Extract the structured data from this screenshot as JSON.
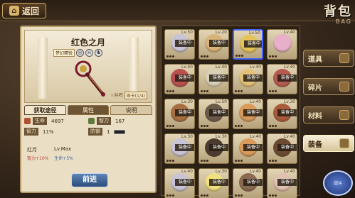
{
  "header": {
    "back_label": "返回",
    "back_icon": "home-icon",
    "title": "背包",
    "subtitle": "BAG"
  },
  "item_detail": {
    "name": "红色之月",
    "rarity_tag": "梦幻精锐",
    "acquire_label": "获取途径",
    "tabs": [
      "属性",
      "说明"
    ],
    "rank_label": "☆共鸣",
    "rank_value": "珠卡(1/4)",
    "stats": [
      {
        "label": "生命",
        "value": "4697"
      },
      {
        "label": "智力",
        "value": "167"
      }
    ],
    "stats2": [
      {
        "label": "智力",
        "value": "11%"
      },
      {
        "label": "防御",
        "value": "1"
      }
    ],
    "skill_name": "红月",
    "skill_level": "Lv.Max",
    "bonus_lines": [
      "智力+10%",
      "生命+5%"
    ],
    "equip_label": "前进"
  },
  "grid": {
    "equipped_label": "装备中",
    "items": [
      {
        "lv": "Lv.50",
        "eq": true,
        "color": "#c9c3d6"
      },
      {
        "lv": "Lv.20",
        "eq": true,
        "color": "#d8b37a"
      },
      {
        "lv": "Lv.50",
        "eq": true,
        "color": "#e5c35a",
        "selected": true
      },
      {
        "lv": "Lv.40",
        "eq": false,
        "color": "#e7b0c8"
      },
      {
        "lv": "Lv.40",
        "eq": true,
        "color": "#b85050"
      },
      {
        "lv": "Lv.40",
        "eq": true,
        "color": "#d9d0b8"
      },
      {
        "lv": "Lv.40",
        "eq": true,
        "color": "#e2c27a"
      },
      {
        "lv": "Lv.40",
        "eq": true,
        "color": "#b55a50"
      },
      {
        "lv": "Lv.30",
        "eq": true,
        "color": "#a87040"
      },
      {
        "lv": "Lv.50",
        "eq": true,
        "color": "#6a5a4a"
      },
      {
        "lv": "Lv.40",
        "eq": true,
        "color": "#d99a5a"
      },
      {
        "lv": "Lv.30",
        "eq": true,
        "color": "#a85a3a"
      },
      {
        "lv": "Lv.30",
        "eq": true,
        "color": "#c9c3d6"
      },
      {
        "lv": "Lv.30",
        "eq": true,
        "color": "#4a3a30"
      },
      {
        "lv": "Lv.40",
        "eq": true,
        "color": "#d99a5a"
      },
      {
        "lv": "Lv.40",
        "eq": true,
        "color": "#6a4a30"
      },
      {
        "lv": "Lv.40",
        "eq": true,
        "color": "#c9c3d6"
      },
      {
        "lv": "Lv.30",
        "eq": true,
        "color": "#f0e080"
      },
      {
        "lv": "Lv.40",
        "eq": true,
        "color": "#8a6a50"
      },
      {
        "lv": "Lv.40",
        "eq": true,
        "color": "#e0c0b0"
      }
    ]
  },
  "side_menu": [
    "道具",
    "碎片",
    "材料",
    "装备"
  ],
  "side_active": "装备",
  "emblem": "战斗"
}
